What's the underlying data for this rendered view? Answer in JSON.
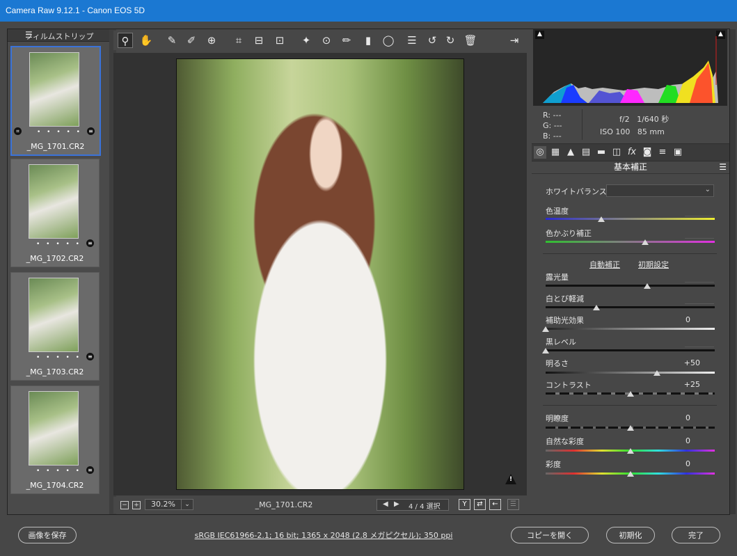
{
  "window": {
    "title": "Camera Raw 9.12.1  -  Canon EOS 5D"
  },
  "filmstrip": {
    "title": "フィルムストリップ",
    "items": [
      {
        "name": "_MG_1701.CR2",
        "selected": true
      },
      {
        "name": "_MG_1702.CR2",
        "selected": false
      },
      {
        "name": "_MG_1703.CR2",
        "selected": false
      },
      {
        "name": "_MG_1704.CR2",
        "selected": false
      }
    ],
    "rating_dots": "• • • • •"
  },
  "toolbar": {
    "tools": [
      "zoom-tool",
      "hand-tool",
      "white-balance-tool",
      "color-sampler-tool",
      "targeted-adjustment-tool",
      "crop-tool",
      "straighten-tool",
      "transform-tool",
      "spot-removal-tool",
      "red-eye-tool",
      "adjustment-brush-tool",
      "graduated-filter-tool",
      "radial-filter-tool",
      "preferences",
      "rotate-left",
      "rotate-right",
      "trash"
    ],
    "active": "zoom-tool"
  },
  "canvas_bar": {
    "zoom": "30.2%",
    "file_name": "_MG_1701.CR2",
    "counter": "4 / 4 選択"
  },
  "readout": {
    "r_label": "R:",
    "r_value": "---",
    "g_label": "G:",
    "g_value": "---",
    "b_label": "B:",
    "b_value": "---",
    "aperture": "f/2",
    "shutter": "1/640 秒",
    "iso": "ISO 100",
    "focal": "85 mm"
  },
  "panel": {
    "title": "基本補正",
    "white_balance_label": "ホワイトバランス :",
    "white_balance_value": "",
    "auto_link": "自動補正",
    "default_link": "初期設定",
    "sliders": [
      {
        "label": "色温度",
        "value": "",
        "fraction": 0.33
      },
      {
        "label": "色かぶり補正",
        "value": "",
        "fraction": 0.59
      },
      {
        "label": "露光量",
        "value": "",
        "fraction": 0.6
      },
      {
        "label": "白とび軽減",
        "value": "",
        "fraction": 0.3
      },
      {
        "label": "補助光効果",
        "value": "0",
        "fraction": 0.0
      },
      {
        "label": "黒レベル",
        "value": "",
        "fraction": 0.0
      },
      {
        "label": "明るさ",
        "value": "+50",
        "fraction": 0.66
      },
      {
        "label": "コントラスト",
        "value": "+25",
        "fraction": 0.5
      },
      {
        "label": "明瞭度",
        "value": "0",
        "fraction": 0.5
      },
      {
        "label": "自然な彩度",
        "value": "0",
        "fraction": 0.5
      },
      {
        "label": "彩度",
        "value": "0",
        "fraction": 0.5
      }
    ]
  },
  "footer": {
    "save_label": "画像を保存",
    "info": "sRGB IEC61966-2.1; 16 bit; 1365 x 2048 (2.8 メガピクセル); 350 ppi",
    "copy_label": "コピーを開く",
    "reset_label": "初期化",
    "done_label": "完了"
  },
  "colors": {
    "accent": "#1b78d2",
    "selection": "#3b73d9"
  }
}
